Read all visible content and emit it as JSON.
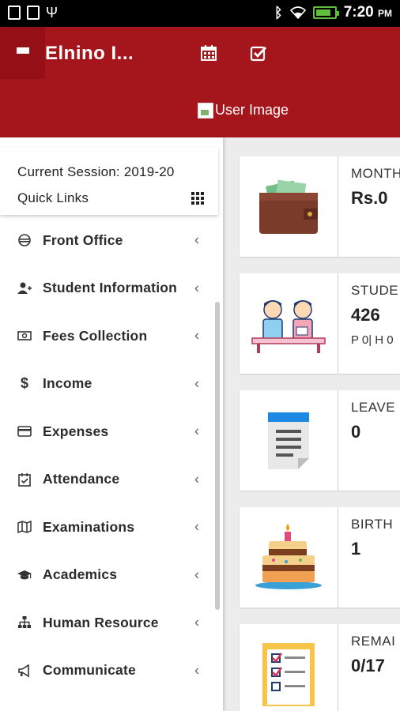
{
  "status_bar": {
    "time": "7:20",
    "ampm": "PM",
    "battery_level": 0.85,
    "colors": {
      "battery": "#5fbf3b"
    }
  },
  "header": {
    "title": "Elnino I...",
    "user_image_alt": "User Image",
    "icons": [
      "menu-icon",
      "calendar-icon",
      "checkbox-icon"
    ],
    "colors": {
      "background": "#a5151c",
      "menu_button": "#951016"
    }
  },
  "sidebar": {
    "session": "Current Session: 2019-20",
    "quick_links": "Quick Links",
    "items": [
      {
        "label": "Front Office",
        "icon": "front-office-icon"
      },
      {
        "label": "Student Information",
        "icon": "student-add-icon"
      },
      {
        "label": "Fees Collection",
        "icon": "money-icon"
      },
      {
        "label": "Income",
        "icon": "dollar-icon"
      },
      {
        "label": "Expenses",
        "icon": "credit-card-icon"
      },
      {
        "label": "Attendance",
        "icon": "calendar-check-icon"
      },
      {
        "label": "Examinations",
        "icon": "map-icon"
      },
      {
        "label": "Academics",
        "icon": "graduation-cap-icon"
      },
      {
        "label": "Human Resource",
        "icon": "sitemap-icon"
      },
      {
        "label": "Communicate",
        "icon": "bullhorn-icon"
      }
    ]
  },
  "cards": [
    {
      "label": "MONTH",
      "value": "Rs.0",
      "sub": "",
      "icon": "wallet-icon"
    },
    {
      "label": "STUDE",
      "value": "426",
      "sub": "P 0| H 0",
      "icon": "students-icon"
    },
    {
      "label": "LEAVE",
      "value": "0",
      "sub": "",
      "icon": "document-icon"
    },
    {
      "label": "BIRTH",
      "value": "1",
      "sub": "",
      "icon": "cake-icon"
    },
    {
      "label": "REMAI",
      "value": "0/17",
      "sub": "",
      "icon": "checklist-icon"
    }
  ]
}
